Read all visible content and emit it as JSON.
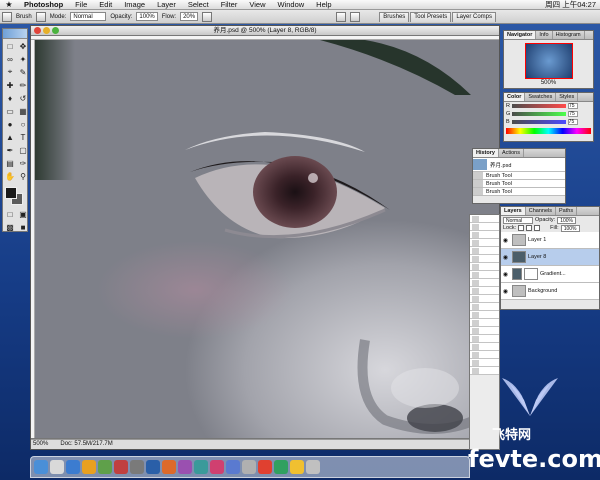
{
  "menubar": {
    "app_name": "Photoshop",
    "items": [
      "File",
      "Edit",
      "Image",
      "Layer",
      "Select",
      "Filter",
      "View",
      "Window",
      "Help"
    ],
    "clock": "周四 上午04:27"
  },
  "options": {
    "tool_label": "Brush",
    "mode_label": "Mode:",
    "mode_value": "Normal",
    "opacity_label": "Opacity:",
    "opacity_value": "100%",
    "flow_label": "Flow:",
    "flow_value": "20%",
    "palette_well_tabs": [
      "Brushes",
      "Tool Presets",
      "Layer Comps"
    ]
  },
  "document": {
    "title": "养月.psd @ 500% (Layer 8, RGB/8)",
    "status_zoom": "500%",
    "status_doc": "Doc: 57.5M/217.7M"
  },
  "navigator": {
    "tabs": [
      "Navigator",
      "Info",
      "Histogram"
    ],
    "zoom": "500%"
  },
  "color_panel": {
    "tabs": [
      "Color",
      "Swatches",
      "Styles"
    ],
    "channels": [
      {
        "label": "R",
        "value": "75",
        "color": "#d03030"
      },
      {
        "label": "G",
        "value": "75",
        "color": "#30a030"
      },
      {
        "label": "B",
        "value": "75",
        "color": "#3050d0"
      }
    ]
  },
  "history": {
    "tabs": [
      "History",
      "Actions"
    ],
    "snapshot": "养月.psd",
    "steps": [
      "Brush Tool",
      "Brush Tool",
      "Brush Tool"
    ]
  },
  "layers": {
    "tabs": [
      "Layers",
      "Channels",
      "Paths"
    ],
    "blend_mode": "Normal",
    "opacity_label": "Opacity:",
    "opacity_value": "100%",
    "lock_label": "Lock:",
    "fill_label": "Fill:",
    "fill_value": "100%",
    "rows": [
      {
        "name": "Layer 1",
        "thumb": "gray",
        "selected": false
      },
      {
        "name": "Layer 8",
        "thumb": "dark",
        "selected": true
      },
      {
        "name": "Gradient...",
        "thumb": "white",
        "selected": false
      },
      {
        "name": "Background",
        "thumb": "gray",
        "selected": false
      }
    ]
  },
  "watermark": {
    "cn": "飞特网",
    "en": "fevte.com"
  }
}
